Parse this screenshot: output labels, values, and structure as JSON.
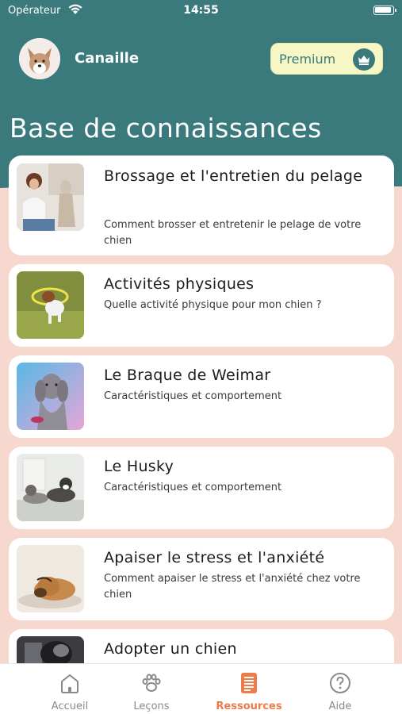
{
  "status": {
    "carrier": "Opérateur",
    "time": "14:55"
  },
  "header": {
    "user_name": "Canaille",
    "premium_label": "Premium",
    "page_title": "Base de connaissances"
  },
  "articles": [
    {
      "title": "Brossage et l'entretien du pelage",
      "subtitle": "Comment brosser et entretenir le pelage de votre chien"
    },
    {
      "title": "Activités physiques",
      "subtitle": "Quelle activité physique pour mon chien ?"
    },
    {
      "title": "Le Braque de Weimar",
      "subtitle": "Caractéristiques et comportement"
    },
    {
      "title": "Le Husky",
      "subtitle": "Caractéristiques et comportement"
    },
    {
      "title": "Apaiser le stress et l'anxiété",
      "subtitle": "Comment apaiser le stress et l'anxiété chez votre chien"
    },
    {
      "title": "Adopter un chien",
      "subtitle": ""
    }
  ],
  "tabs": [
    {
      "label": "Accueil",
      "icon": "home-icon"
    },
    {
      "label": "Leçons",
      "icon": "paw-icon"
    },
    {
      "label": "Ressources",
      "icon": "document-icon"
    },
    {
      "label": "Aide",
      "icon": "help-icon"
    }
  ],
  "colors": {
    "primary": "#3b7a7c",
    "accent": "#ee7b4a",
    "background": "#f7d8cf",
    "premium_bg": "#f6f7c4"
  }
}
